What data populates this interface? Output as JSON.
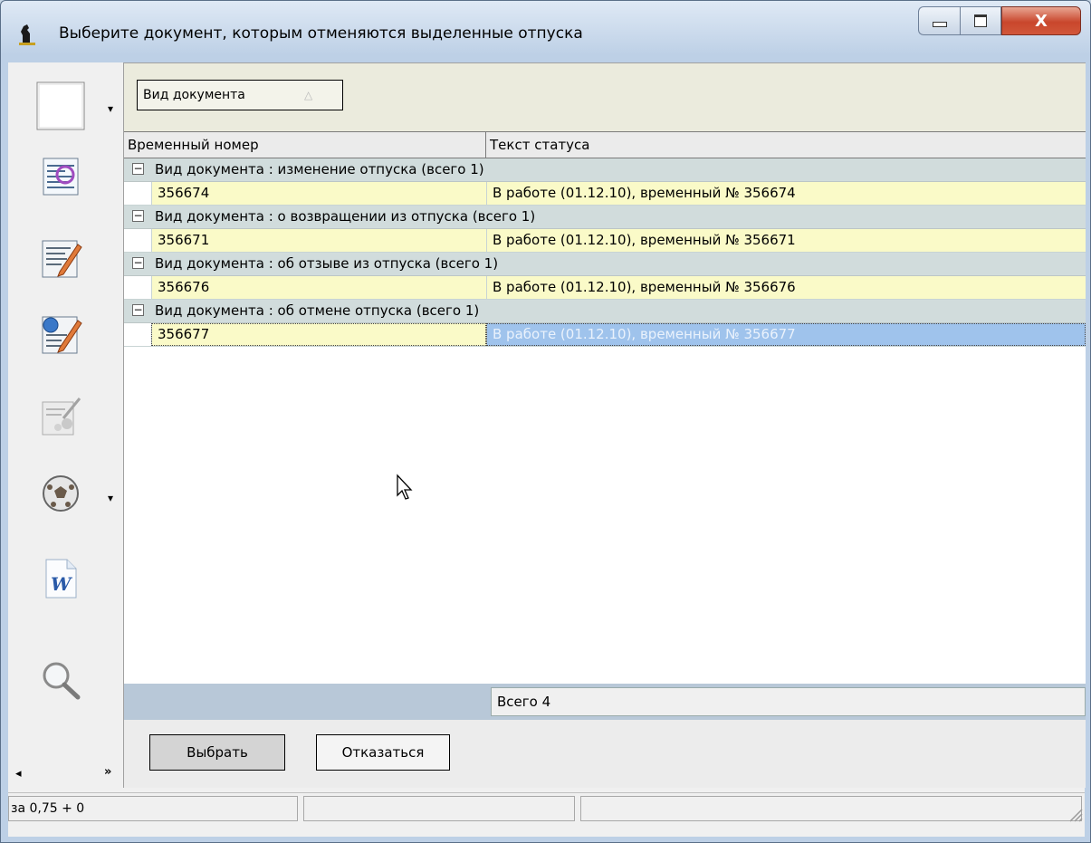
{
  "window": {
    "title": "Выберите документ, которым отменяются выделенные отпуска",
    "minimize_icon": "minimize-icon",
    "maximize_icon": "maximize-icon",
    "close_label": "X"
  },
  "toolbar": {
    "icons": [
      "blank-document-icon",
      "document-text-icon",
      "edit-document-icon",
      "edit-document-refresh-icon",
      "settings-tools-icon",
      "ball-icon",
      "word-icon",
      "search-icon"
    ],
    "scroll_left": "◂",
    "scroll_more": "»"
  },
  "grouping": {
    "chip_label": "Вид документа",
    "sort_indicator": "△"
  },
  "grid": {
    "columns": [
      "Временный номер",
      "Текст статуса"
    ],
    "groups": [
      {
        "label": "Вид документа : изменение отпуска (всего 1)",
        "rows": [
          {
            "number": "356674",
            "status": "В работе (01.12.10), временный № 356674"
          }
        ]
      },
      {
        "label": "Вид документа : о возвращении из отпуска (всего 1)",
        "rows": [
          {
            "number": "356671",
            "status": "В работе (01.12.10), временный № 356671"
          }
        ]
      },
      {
        "label": "Вид документа : об отзыве из отпуска (всего 1)",
        "rows": [
          {
            "number": "356676",
            "status": "В работе (01.12.10), временный № 356676"
          }
        ]
      },
      {
        "label": "Вид документа : об отмене отпуска (всего 1)",
        "rows": [
          {
            "number": "356677",
            "status": "В работе (01.12.10), временный № 356677",
            "selected": true
          }
        ]
      }
    ],
    "total": "Всего 4"
  },
  "buttons": {
    "select": "Выбрать",
    "cancel": "Отказаться"
  },
  "status_bar": {
    "panel1": "за 0,75 + 0",
    "panel2": "",
    "panel3": ""
  },
  "colors": {
    "row_background": "#fafac8",
    "selection": "#9fc3ec",
    "group_row": "#d1dcdc"
  }
}
